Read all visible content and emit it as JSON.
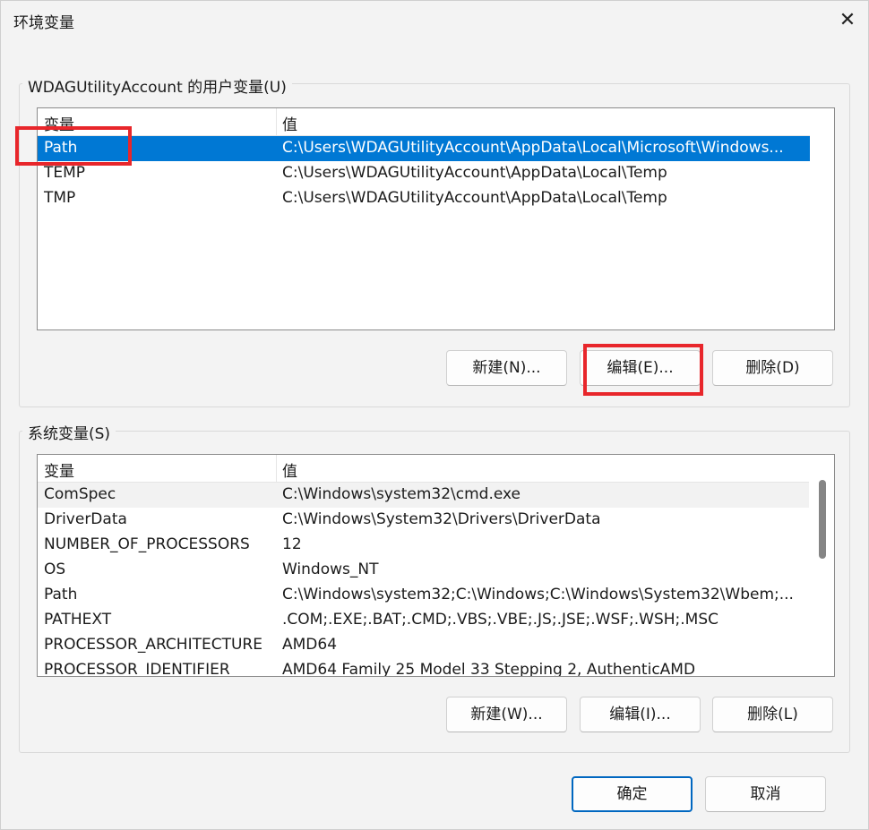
{
  "window": {
    "title": "环境变量",
    "close_glyph": "✕"
  },
  "user_vars": {
    "group_title": "WDAGUtilityAccount 的用户变量(U)",
    "columns": [
      "变量",
      "值"
    ],
    "rows": [
      {
        "name": "Path",
        "value": "C:\\Users\\WDAGUtilityAccount\\AppData\\Local\\Microsoft\\Windows..."
      },
      {
        "name": "TEMP",
        "value": "C:\\Users\\WDAGUtilityAccount\\AppData\\Local\\Temp"
      },
      {
        "name": "TMP",
        "value": "C:\\Users\\WDAGUtilityAccount\\AppData\\Local\\Temp"
      }
    ],
    "buttons": {
      "new": "新建(N)...",
      "edit": "编辑(E)...",
      "delete": "删除(D)"
    }
  },
  "system_vars": {
    "group_title": "系统变量(S)",
    "columns": [
      "变量",
      "值"
    ],
    "rows": [
      {
        "name": "ComSpec",
        "value": "C:\\Windows\\system32\\cmd.exe"
      },
      {
        "name": "DriverData",
        "value": "C:\\Windows\\System32\\Drivers\\DriverData"
      },
      {
        "name": "NUMBER_OF_PROCESSORS",
        "value": "12"
      },
      {
        "name": "OS",
        "value": "Windows_NT"
      },
      {
        "name": "Path",
        "value": "C:\\Windows\\system32;C:\\Windows;C:\\Windows\\System32\\Wbem;..."
      },
      {
        "name": "PATHEXT",
        "value": ".COM;.EXE;.BAT;.CMD;.VBS;.VBE;.JS;.JSE;.WSF;.WSH;.MSC"
      },
      {
        "name": "PROCESSOR_ARCHITECTURE",
        "value": "AMD64"
      },
      {
        "name": "PROCESSOR_IDENTIFIER",
        "value": "AMD64 Family 25 Model 33 Stepping 2, AuthenticAMD"
      }
    ],
    "buttons": {
      "new": "新建(W)...",
      "edit": "编辑(I)...",
      "delete": "删除(L)"
    }
  },
  "footer": {
    "ok": "确定",
    "cancel": "取消"
  },
  "colors": {
    "selection": "#0078d4",
    "annotation": "#e8262b",
    "primary_border": "#0067c0"
  }
}
